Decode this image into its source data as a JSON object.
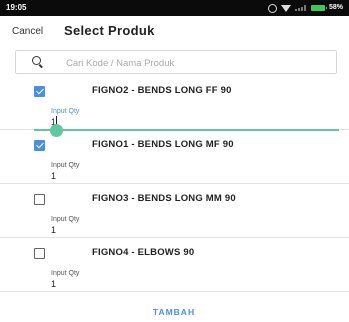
{
  "status_bar": {
    "time": "19:05",
    "battery": "58%"
  },
  "header": {
    "cancel_label": "Cancel",
    "title": "Select Produk"
  },
  "search": {
    "placeholder": "Cari Kode / Nama Produk",
    "value": ""
  },
  "items": [
    {
      "name": "FIGNO2 - BENDS LONG FF 90",
      "checked": true,
      "qty_label": "Input Qty",
      "qty": "1",
      "focused": true
    },
    {
      "name": "FIGNO1 - BENDS LONG MF 90",
      "checked": true,
      "qty_label": "Input Qty",
      "qty": "1",
      "focused": false
    },
    {
      "name": "FIGNO3 - BENDS LONG MM 90",
      "checked": false,
      "qty_label": "Input Qty",
      "qty": "1",
      "focused": false
    },
    {
      "name": "FIGNO4 - ELBOWS 90",
      "checked": false,
      "qty_label": "Input Qty",
      "qty": "1",
      "focused": false
    }
  ],
  "footer": {
    "submit_label": "TAMBAH"
  },
  "colors": {
    "accent": "#4a90e2",
    "focus": "#62c7a1"
  }
}
